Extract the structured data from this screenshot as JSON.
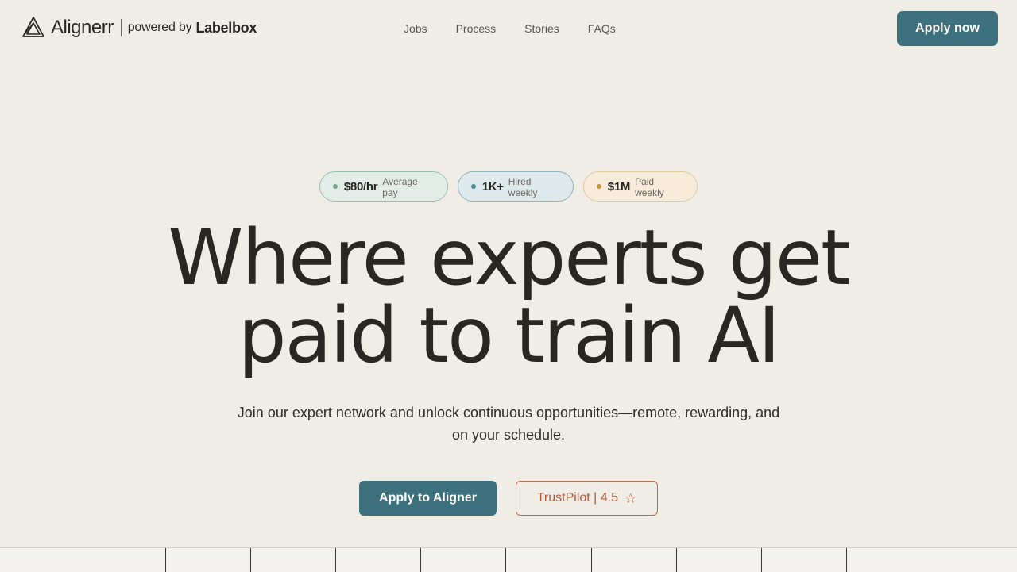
{
  "brand": {
    "name": "Alignerr",
    "powered_by": "powered by",
    "partner": "Labelbox",
    "logo_icon": "aligner-triangle-icon"
  },
  "nav": {
    "items": [
      {
        "label": "Jobs"
      },
      {
        "label": "Process"
      },
      {
        "label": "Stories"
      },
      {
        "label": "FAQs"
      }
    ]
  },
  "header_cta": {
    "label": "Apply now"
  },
  "stats": [
    {
      "value": "$80/hr",
      "label": "Average pay",
      "dot_color": "#7aa596"
    },
    {
      "value": "1K+",
      "label": "Hired weekly",
      "dot_color": "#4f8f9c"
    },
    {
      "value": "$1M",
      "label": "Paid weekly",
      "dot_color": "#c9963f"
    }
  ],
  "hero": {
    "headline_line1": "Where experts get",
    "headline_line2": "paid to train AI",
    "subheadline": "Join our expert network and unlock continuous opportunities—remote, rewarding, and on your schedule."
  },
  "ctas": {
    "primary": "Apply to Aligner",
    "secondary": "TrustPilot | 4.5",
    "secondary_icon": "star-outline-icon"
  },
  "colors": {
    "background": "#f0ede7",
    "accent": "#3b707c",
    "trustpilot": "#b05a3a"
  }
}
